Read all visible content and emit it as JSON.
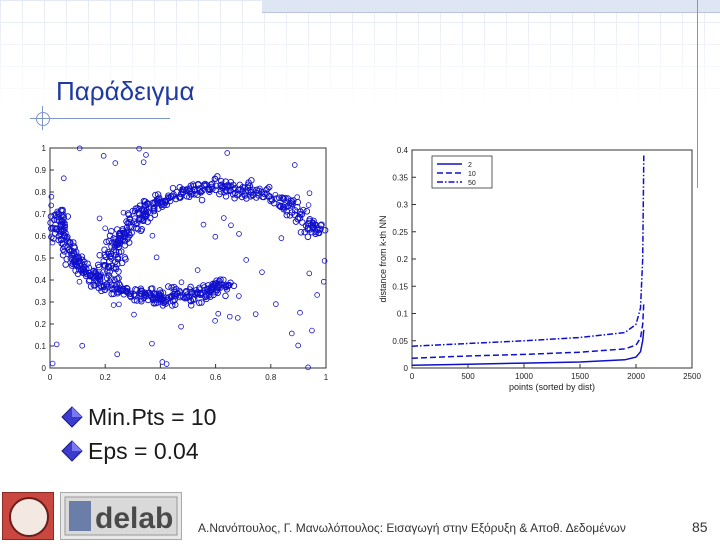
{
  "slide": {
    "title": "Παράδειγμα",
    "bullets": [
      "Min.Pts = 10",
      "Eps = 0.04"
    ],
    "footer": {
      "authors": "Α.Νανόπουλος, Γ. Μανωλόπουλος: Εισαγωγή στην Εξόρυξη & Αποθ. Δεδομένων",
      "page": "85",
      "logo_text": "delab"
    },
    "colors": {
      "title": "#1f3aa0",
      "points": "#1010cc",
      "accent": "#7e95c8"
    }
  },
  "chart_data": [
    {
      "type": "scatter",
      "title": "",
      "xlabel": "",
      "ylabel": "",
      "xlim": [
        0,
        1
      ],
      "ylim": [
        0,
        1
      ],
      "xticks": [
        "0",
        "0.2",
        "0.4",
        "0.6",
        "0.8",
        "1"
      ],
      "yticks": [
        "0",
        "0.1",
        "0.2",
        "0.3",
        "0.4",
        "0.5",
        "0.6",
        "0.7",
        "0.8",
        "0.9",
        "1"
      ],
      "marker": "open-circle",
      "series": [
        {
          "description_shape": "upper arc",
          "center": [
            0.62,
            0.42
          ],
          "radius": 0.4,
          "theta_range": [
            0.5,
            3.14
          ],
          "count": 380
        },
        {
          "description_shape": "lower arc",
          "center": [
            0.42,
            0.72
          ],
          "radius": 0.4,
          "theta_range": [
            -3.14,
            -0.95
          ],
          "count": 380
        }
      ]
    },
    {
      "type": "line",
      "title": "",
      "xlabel": "points (sorted by dist)",
      "ylabel": "distance from k-th NN",
      "xlim": [
        0,
        2500
      ],
      "ylim": [
        0,
        0.4
      ],
      "xticks": [
        "0",
        "500",
        "1000",
        "1500",
        "2000",
        "2500"
      ],
      "yticks": [
        "0",
        "0.05",
        "0.1",
        "0.15",
        "0.2",
        "0.25",
        "0.3",
        "0.35",
        "0.4"
      ],
      "legend": {
        "position": "top-left",
        "entries": [
          "2",
          "10",
          "50"
        ]
      },
      "series": [
        {
          "name": "2",
          "style": "solid",
          "x": [
            0,
            500,
            1000,
            1500,
            1900,
            2000,
            2040,
            2060,
            2070
          ],
          "y": [
            0.005,
            0.007,
            0.009,
            0.011,
            0.015,
            0.02,
            0.03,
            0.05,
            0.07
          ]
        },
        {
          "name": "10",
          "style": "dashed",
          "x": [
            0,
            500,
            1000,
            1500,
            1900,
            2000,
            2040,
            2060,
            2070
          ],
          "y": [
            0.018,
            0.022,
            0.025,
            0.029,
            0.035,
            0.042,
            0.055,
            0.08,
            0.12
          ]
        },
        {
          "name": "50",
          "style": "dashdot",
          "x": [
            0,
            500,
            1000,
            1500,
            1900,
            2000,
            2040,
            2060,
            2070
          ],
          "y": [
            0.04,
            0.045,
            0.05,
            0.056,
            0.065,
            0.08,
            0.11,
            0.2,
            0.39
          ]
        }
      ]
    }
  ]
}
